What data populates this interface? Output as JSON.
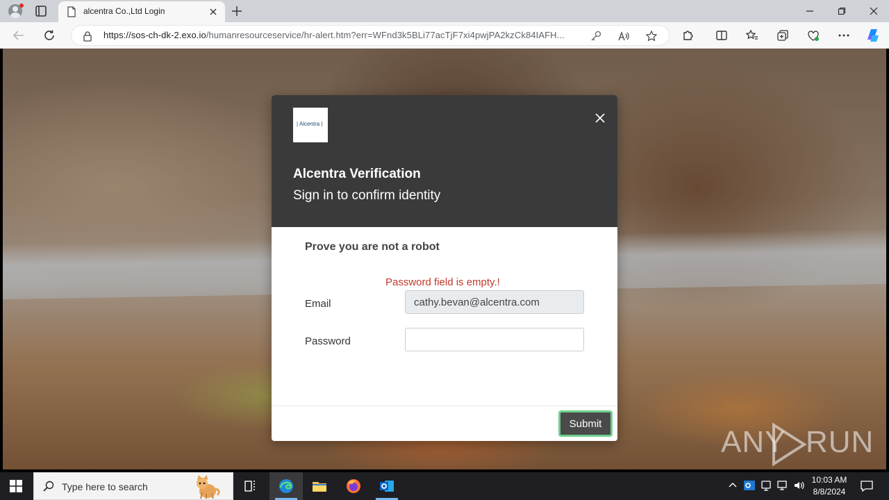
{
  "browser": {
    "tab_title": "alcentra Co.,Ltd Login",
    "url_host": "https://sos-ch-dk-2.exo.io",
    "url_path": "/humanresourceservice/hr-alert.htm?err=WFnd3k5BLi77acTjF7xi4pwjPA2kzCk84IAFH..."
  },
  "modal": {
    "logo_text": "| Alcentra |",
    "title": "Alcentra Verification",
    "subtitle": "Sign in to confirm identity",
    "heading": "Prove you are not a robot",
    "error": "Password field is empty.!",
    "email_label": "Email",
    "email_value": "cathy.bevan@alcentra.com",
    "password_label": "Password",
    "password_value": "",
    "submit_label": "Submit"
  },
  "watermark": {
    "left": "ANY",
    "right": "RUN"
  },
  "taskbar": {
    "search_placeholder": "Type here to search",
    "time": "10:03 AM",
    "date": "8/8/2024"
  },
  "colors": {
    "modal_header": "#3a3a3a",
    "error": "#c0392b",
    "submit_bg": "#4a4a4a",
    "submit_border": "#6fd08c",
    "taskbar": "#1f1f23"
  }
}
